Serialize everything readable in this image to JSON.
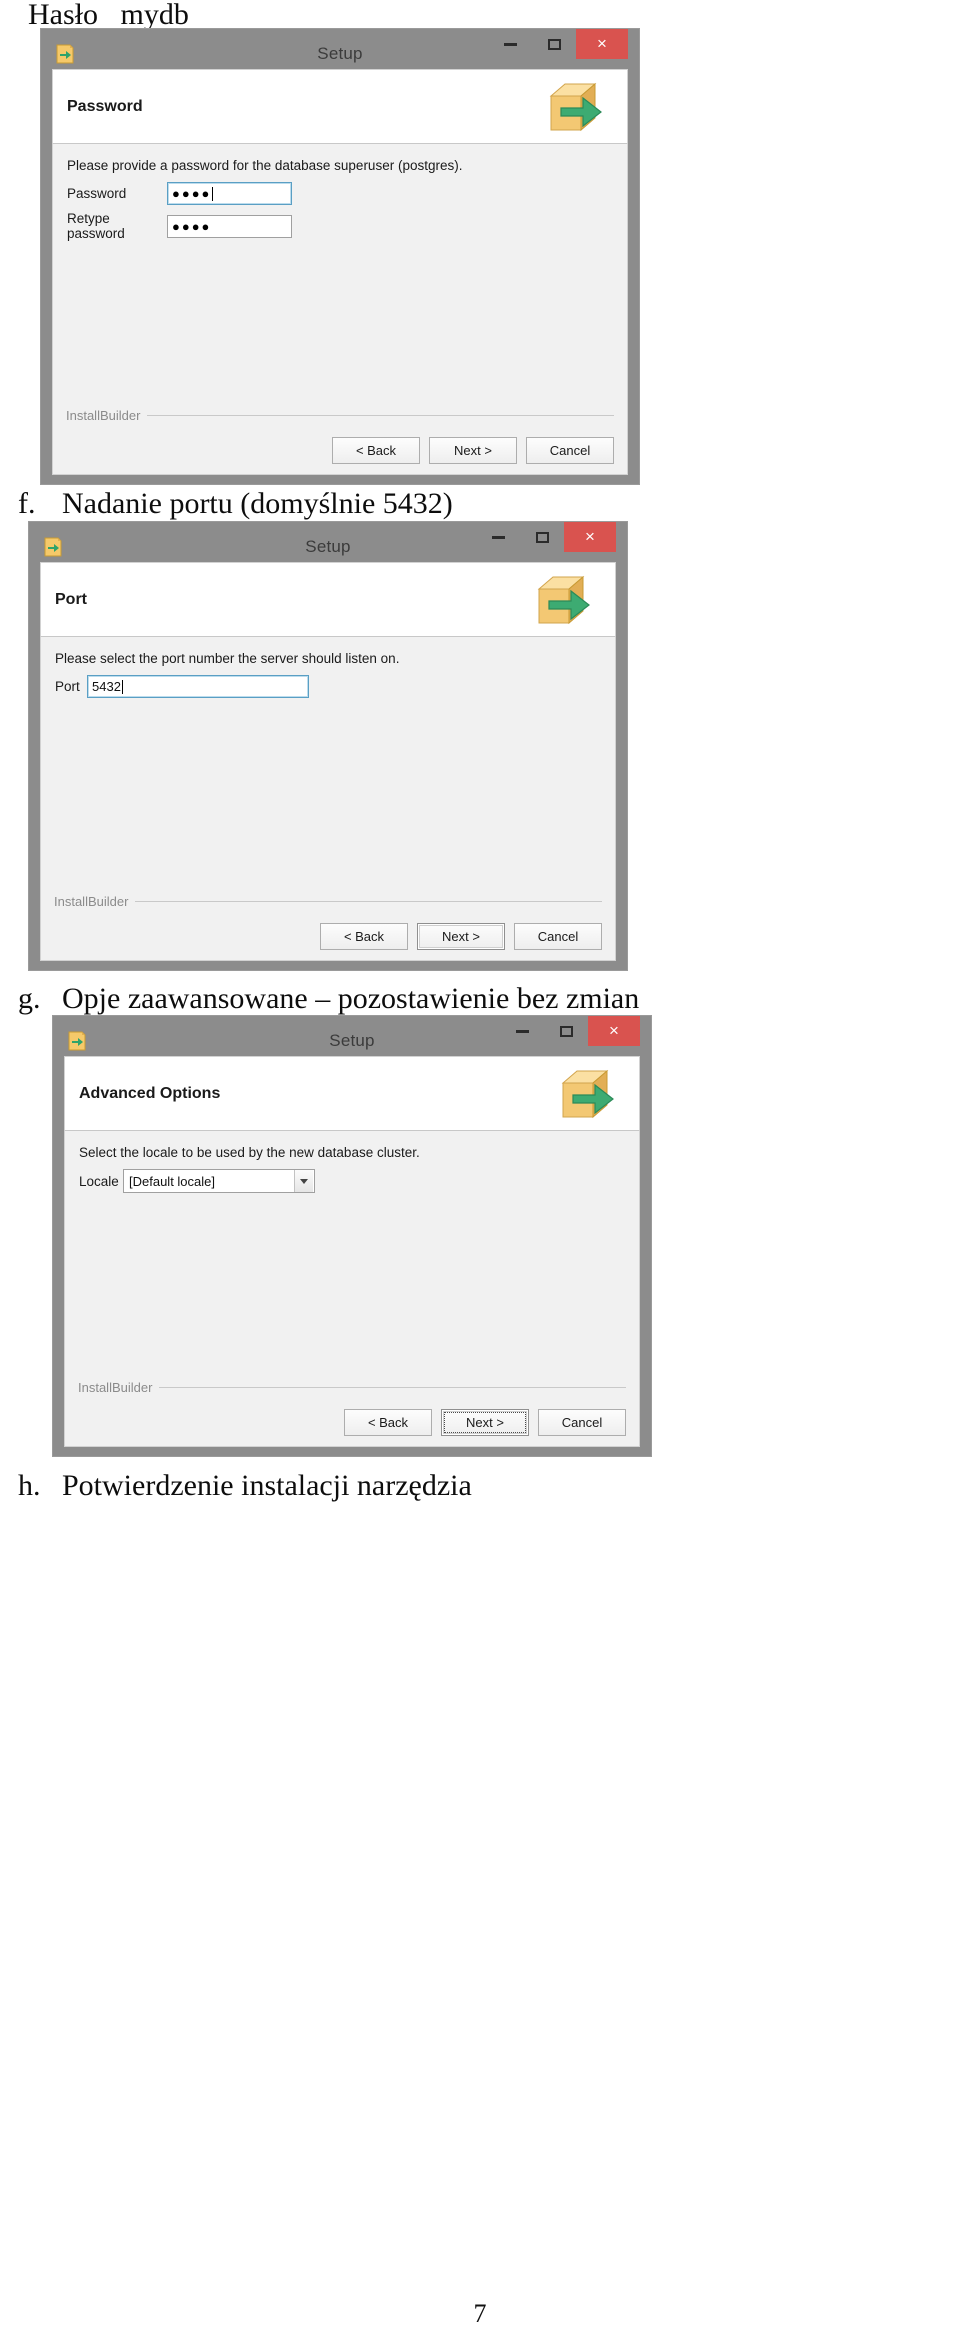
{
  "document": {
    "heading": "Hasło   mydb",
    "page_number": "7",
    "captions": [
      {
        "marker": "f.",
        "text": "Nadanie portu (domyślnie 5432)"
      },
      {
        "marker": "g.",
        "text": "Opje zaawansowane – pozostawienie bez zmian"
      },
      {
        "marker": "h.",
        "text": "Potwierdzenie instalacji narzędzia"
      }
    ]
  },
  "colors": {
    "titlebar": "#8c8c8c",
    "close_button": "#d9534f",
    "panel": "#f1f1f1",
    "focus_border": "#5a9fc4",
    "brand_text": "#8b8b8b"
  },
  "windows": [
    {
      "titlebar": {
        "title": "Setup",
        "app_icon": "installer-arrow-icon",
        "minimize_label": "–",
        "maximize_label": "□",
        "close_label": "×"
      },
      "header": {
        "title": "Password",
        "artwork": "green-arrow-box-icon"
      },
      "content": {
        "prompt": "Please provide a password for the database superuser (postgres).",
        "fields": [
          {
            "label": "Password",
            "value": "●●●●",
            "type": "password",
            "focused": true
          },
          {
            "label": "Retype password",
            "value": "●●●●",
            "type": "password",
            "focused": false
          }
        ]
      },
      "footer": {
        "brand": "InstallBuilder",
        "buttons": [
          {
            "label": "< Back",
            "state": "normal"
          },
          {
            "label": "Next >",
            "state": "normal"
          },
          {
            "label": "Cancel",
            "state": "normal"
          }
        ]
      }
    },
    {
      "titlebar": {
        "title": "Setup",
        "app_icon": "installer-arrow-icon",
        "minimize_label": "–",
        "maximize_label": "□",
        "close_label": "×"
      },
      "header": {
        "title": "Port",
        "artwork": "green-arrow-box-icon"
      },
      "content": {
        "prompt": "Please select the port number the server should listen on.",
        "fields": [
          {
            "label": "Port",
            "value": "5432",
            "type": "text",
            "focused": true
          }
        ]
      },
      "footer": {
        "brand": "InstallBuilder",
        "buttons": [
          {
            "label": "< Back",
            "state": "normal"
          },
          {
            "label": "Next >",
            "state": "default"
          },
          {
            "label": "Cancel",
            "state": "normal"
          }
        ]
      }
    },
    {
      "titlebar": {
        "title": "Setup",
        "app_icon": "installer-arrow-icon",
        "minimize_label": "–",
        "maximize_label": "□",
        "close_label": "×"
      },
      "header": {
        "title": "Advanced Options",
        "artwork": "green-arrow-box-icon"
      },
      "content": {
        "prompt": "Select the locale to be used by the new database cluster.",
        "fields": [
          {
            "label": "Locale",
            "value": "[Default locale]",
            "type": "combobox",
            "focused": false
          }
        ]
      },
      "footer": {
        "brand": "InstallBuilder",
        "buttons": [
          {
            "label": "< Back",
            "state": "normal"
          },
          {
            "label": "Next >",
            "state": "default-focused"
          },
          {
            "label": "Cancel",
            "state": "normal"
          }
        ]
      }
    }
  ]
}
